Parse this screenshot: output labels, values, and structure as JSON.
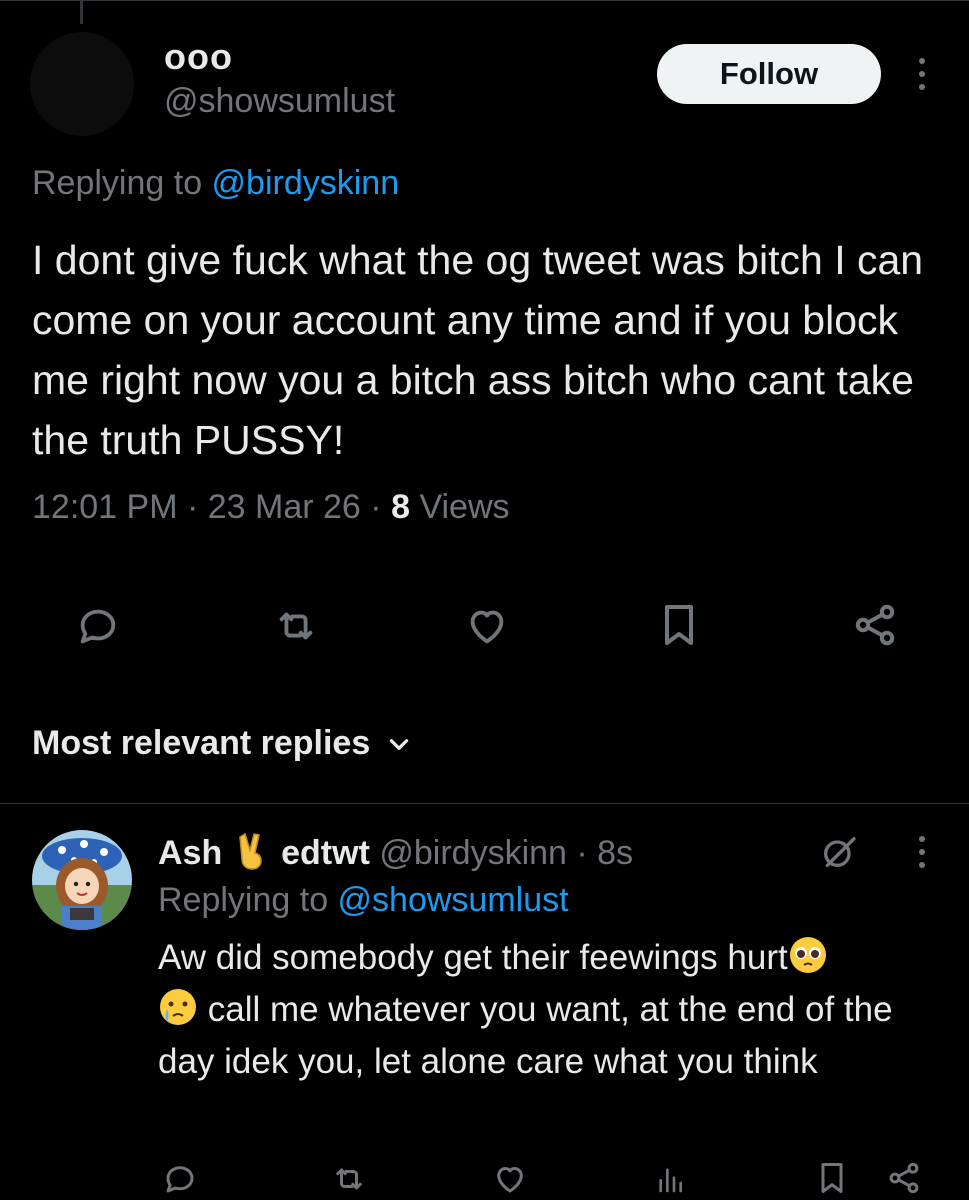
{
  "tweet": {
    "display_name": "ooo",
    "handle": "@showsumlust",
    "follow_label": "Follow",
    "replying_prefix": "Replying to ",
    "replying_to": "@birdyskinn",
    "text": "I dont give fuck what the og tweet was bitch I can come on your account any time and if you block me right now you a bitch ass bitch who cant take the truth PUSSY!",
    "time": "12:01 PM",
    "date": "23 Mar 26",
    "views_count": "8",
    "views_label": "Views",
    "separator": " · "
  },
  "sort": {
    "label": "Most relevant replies"
  },
  "reply": {
    "display_name_a": "Ash ",
    "display_name_b": " edtwt",
    "handle": "@birdyskinn",
    "age": "8s",
    "separator": " · ",
    "replying_prefix": "Replying to ",
    "replying_to": "@showsumlust",
    "text_1": "Aw did somebody get their feewings hurt",
    "text_2": " call me whatever you want, at the end of the day idek you,  let alone care what you think"
  },
  "icons": {
    "reply": "reply-icon",
    "repost": "repost-icon",
    "like": "heart-icon",
    "bookmark": "bookmark-icon",
    "share": "share-icon",
    "views": "analytics-icon",
    "grok": "grok-icon",
    "more": "more-vertical-icon",
    "sort": "chevron-down-icon",
    "victory": "victory-hand-emoji",
    "pleading": "pleading-face-emoji",
    "crying": "crying-face-emoji"
  },
  "colors": {
    "background": "#000000",
    "text": "#e7e9ea",
    "secondary": "#71767b",
    "link": "#1d9bf0",
    "follow_bg": "#eff3f4"
  }
}
